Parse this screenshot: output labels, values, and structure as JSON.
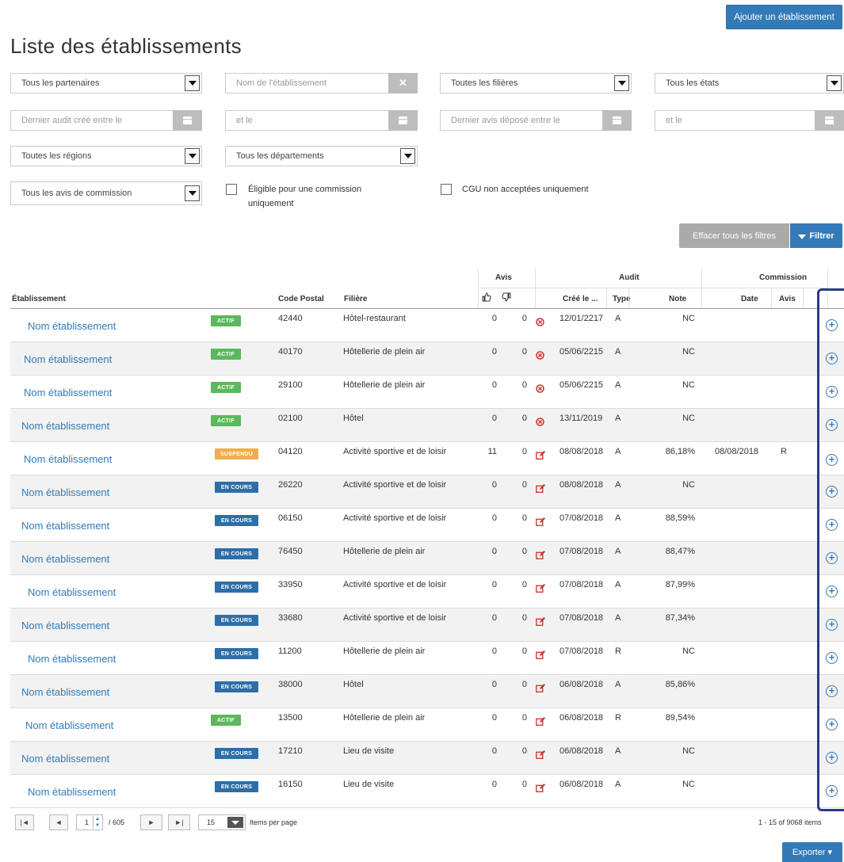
{
  "page_title": "Liste des établissements",
  "add_button": "Ajouter un établissement",
  "filters": {
    "partners": "Tous les partenaires",
    "name_placeholder": "Nom de l'établissement",
    "sectors": "Toutes les filières",
    "states": "Tous les états",
    "audit_from_placeholder": "Dernier audit créé entre le",
    "audit_to_placeholder": "et le",
    "review_from_placeholder": "Dernier avis déposé entre le",
    "review_to_placeholder": "et le",
    "regions": "Toutes les régions",
    "departments": "Tous les départements",
    "commission_reviews": "Tous les avis de commission",
    "eligible_line1": "Éligible pour une commission",
    "eligible_line2": "uniquement",
    "cgu_label": "CGU non acceptées uniquement",
    "clear_button": "Effacer tous les filtres",
    "filter_button": "Filtrer"
  },
  "table": {
    "group_headers": {
      "reviews": "Avis",
      "audit": "Audit",
      "commission": "Commission"
    },
    "headers": {
      "establishment": "Établissement",
      "postal_code": "Code Postal",
      "sector": "Filière",
      "created": "Créé le ...",
      "type": "Type",
      "score": "Note",
      "date": "Date",
      "review": "Avis"
    },
    "rows": [
      {
        "name": "Nom établissement",
        "status": "ACTIF",
        "status_kind": "actif",
        "cp": "42440",
        "sector": "Hôtel-restaurant",
        "pos": "0",
        "neg": "0",
        "audit_icon": "cancel-circle-icon",
        "created": "12/01/2217",
        "type": "A",
        "score": "NC",
        "cdate": "",
        "cavis": ""
      },
      {
        "name": "Nom établissement",
        "status": "ACTIF",
        "status_kind": "actif",
        "cp": "40170",
        "sector": "Hôtellerie de plein air",
        "pos": "0",
        "neg": "0",
        "audit_icon": "cancel-circle-icon",
        "created": "05/06/2215",
        "type": "A",
        "score": "NC",
        "cdate": "",
        "cavis": ""
      },
      {
        "name": "Nom établissement",
        "status": "ACTIF",
        "status_kind": "actif",
        "cp": "29100",
        "sector": "Hôtellerie de plein air",
        "pos": "0",
        "neg": "0",
        "audit_icon": "cancel-circle-icon",
        "created": "05/06/2215",
        "type": "A",
        "score": "NC",
        "cdate": "",
        "cavis": ""
      },
      {
        "name": "Nom établissement",
        "status": "ACTIF",
        "status_kind": "actif",
        "cp": "02100",
        "sector": "Hôtel",
        "pos": "0",
        "neg": "0",
        "audit_icon": "cancel-circle-icon",
        "created": "13/11/2019",
        "type": "A",
        "score": "NC",
        "cdate": "",
        "cavis": ""
      },
      {
        "name": "Nom établissement",
        "status": "SUSPENDU",
        "status_kind": "suspendu",
        "cp": "04120",
        "sector": "Activité sportive et de loisir",
        "pos": "11",
        "neg": "0",
        "audit_icon": "edit-icon",
        "created": "08/08/2018",
        "type": "A",
        "score": "86,18%",
        "cdate": "08/08/2018",
        "cavis": "R"
      },
      {
        "name": "Nom établissement",
        "status": "EN COURS",
        "status_kind": "encours",
        "cp": "26220",
        "sector": "Activité sportive et de loisir",
        "pos": "0",
        "neg": "0",
        "audit_icon": "edit-icon",
        "created": "08/08/2018",
        "type": "A",
        "score": "NC",
        "cdate": "",
        "cavis": ""
      },
      {
        "name": "Nom établissement",
        "status": "EN COURS",
        "status_kind": "encours",
        "cp": "06150",
        "sector": "Activité sportive et de loisir",
        "pos": "0",
        "neg": "0",
        "audit_icon": "edit-icon",
        "created": "07/08/2018",
        "type": "A",
        "score": "88,59%",
        "cdate": "",
        "cavis": ""
      },
      {
        "name": "Nom établissement",
        "status": "EN COURS",
        "status_kind": "encours",
        "cp": "76450",
        "sector": "Hôtellerie de plein air",
        "pos": "0",
        "neg": "0",
        "audit_icon": "edit-icon",
        "created": "07/08/2018",
        "type": "A",
        "score": "88,47%",
        "cdate": "",
        "cavis": ""
      },
      {
        "name": "Nom établissement",
        "status": "EN COURS",
        "status_kind": "encours",
        "cp": "33950",
        "sector": "Activité sportive et de loisir",
        "pos": "0",
        "neg": "0",
        "audit_icon": "edit-icon",
        "created": "07/08/2018",
        "type": "A",
        "score": "87,99%",
        "cdate": "",
        "cavis": ""
      },
      {
        "name": "Nom établissement",
        "status": "EN COURS",
        "status_kind": "encours",
        "cp": "33680",
        "sector": "Activité sportive et de loisir",
        "pos": "0",
        "neg": "0",
        "audit_icon": "edit-icon",
        "created": "07/08/2018",
        "type": "A",
        "score": "87,34%",
        "cdate": "",
        "cavis": ""
      },
      {
        "name": "Nom établissement",
        "status": "EN COURS",
        "status_kind": "encours",
        "cp": "11200",
        "sector": "Hôtellerie de plein air",
        "pos": "0",
        "neg": "0",
        "audit_icon": "edit-icon",
        "created": "07/08/2018",
        "type": "R",
        "score": "NC",
        "cdate": "",
        "cavis": ""
      },
      {
        "name": "Nom établissement",
        "status": "EN COURS",
        "status_kind": "encours",
        "cp": "38000",
        "sector": "Hôtel",
        "pos": "0",
        "neg": "0",
        "audit_icon": "edit-icon",
        "created": "06/08/2018",
        "type": "A",
        "score": "85,86%",
        "cdate": "",
        "cavis": ""
      },
      {
        "name": "Nom établissement",
        "status": "ACTIF",
        "status_kind": "actif",
        "cp": "13500",
        "sector": "Hôtellerie de plein air",
        "pos": "0",
        "neg": "0",
        "audit_icon": "edit-icon",
        "created": "06/08/2018",
        "type": "R",
        "score": "89,54%",
        "cdate": "",
        "cavis": ""
      },
      {
        "name": "Nom établissement",
        "status": "EN COURS",
        "status_kind": "encours",
        "cp": "17210",
        "sector": "Lieu de visite",
        "pos": "0",
        "neg": "0",
        "audit_icon": "edit-icon",
        "created": "06/08/2018",
        "type": "A",
        "score": "NC",
        "cdate": "",
        "cavis": ""
      },
      {
        "name": "Nom établissement",
        "status": "EN COURS",
        "status_kind": "encours",
        "cp": "16150",
        "sector": "Lieu de visite",
        "pos": "0",
        "neg": "0",
        "audit_icon": "edit-icon",
        "created": "06/08/2018",
        "type": "A",
        "score": "NC",
        "cdate": "",
        "cavis": ""
      }
    ]
  },
  "pager": {
    "current_page": "1",
    "total_pages": "/ 605",
    "page_size": "15",
    "items_per_page_label": "Items per page",
    "summary": "1 - 15 of 9068 items"
  },
  "export_button": "Exporter",
  "colors": {
    "primary": "#337ab7",
    "actif": "#5cb85c",
    "encours": "#2e6ea8",
    "suspendu": "#f0ad4e",
    "highlight_box": "#2b3a86"
  }
}
